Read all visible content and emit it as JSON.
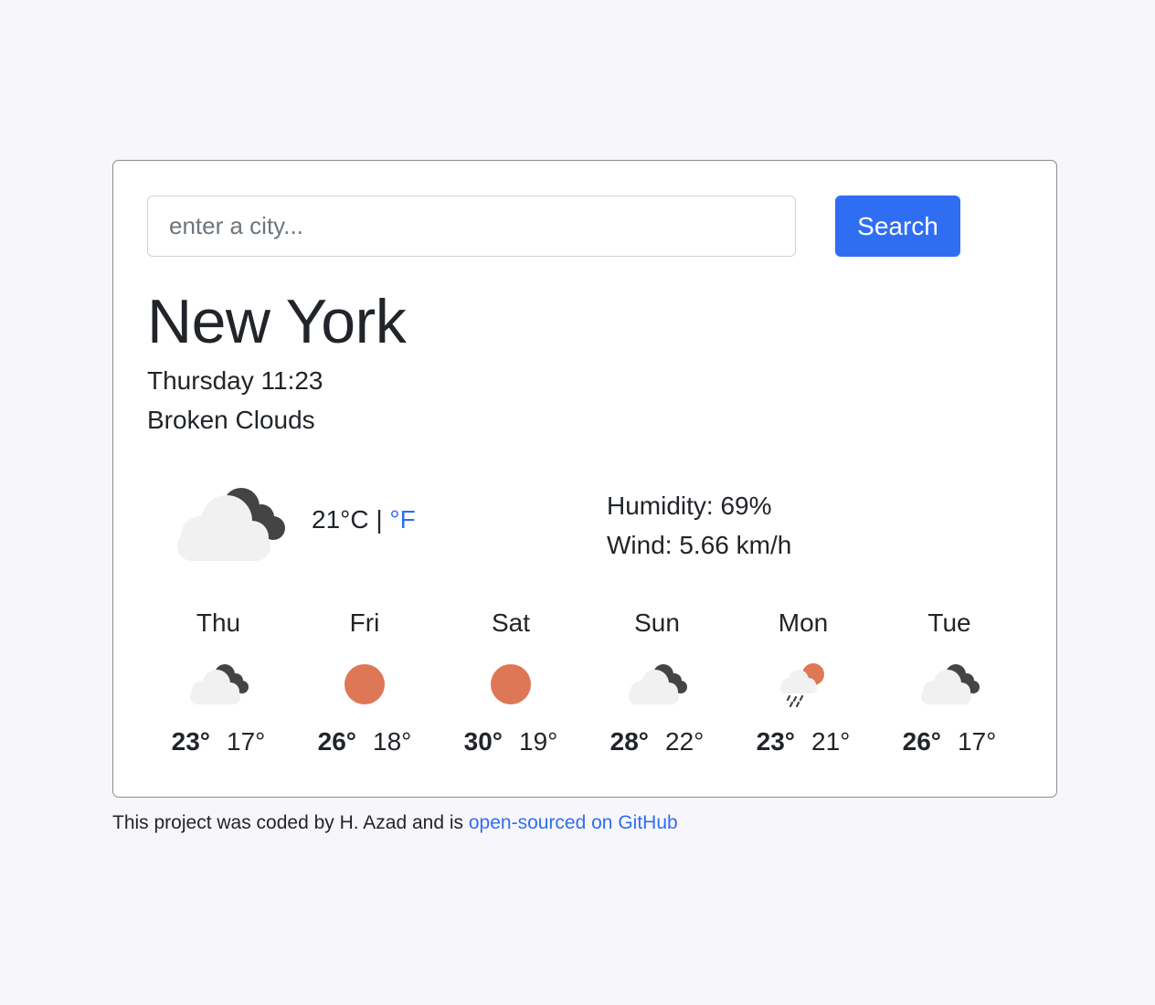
{
  "search": {
    "placeholder": "enter a city...",
    "value": "",
    "button_label": "Search"
  },
  "current": {
    "city": "New York",
    "datetime": "Thursday 11:23",
    "description": "Broken Clouds",
    "icon": "broken-clouds-icon",
    "temperature": "21",
    "unit_celsius": "°C",
    "separator": "|",
    "unit_fahrenheit": "°F",
    "humidity_label": "Humidity: 69%",
    "wind_label": "Wind: 5.66 km/h"
  },
  "forecast": [
    {
      "day": "Thu",
      "icon": "broken-clouds-icon",
      "max": "23°",
      "min": "17°"
    },
    {
      "day": "Fri",
      "icon": "sun-icon",
      "max": "26°",
      "min": "18°"
    },
    {
      "day": "Sat",
      "icon": "sun-icon",
      "max": "30°",
      "min": "19°"
    },
    {
      "day": "Sun",
      "icon": "broken-clouds-icon",
      "max": "28°",
      "min": "22°"
    },
    {
      "day": "Mon",
      "icon": "rain-sun-icon",
      "max": "23°",
      "min": "21°"
    },
    {
      "day": "Tue",
      "icon": "broken-clouds-icon",
      "max": "26°",
      "min": "17°"
    }
  ],
  "footer": {
    "text": "This project was coded by H. Azad and is ",
    "link_label": "open-sourced on GitHub"
  },
  "colors": {
    "background": "#f7f6fb",
    "accent": "#2f6ef2",
    "sun": "#de7756",
    "cloud_light": "#f1f1f1",
    "cloud_dark": "#444444"
  }
}
